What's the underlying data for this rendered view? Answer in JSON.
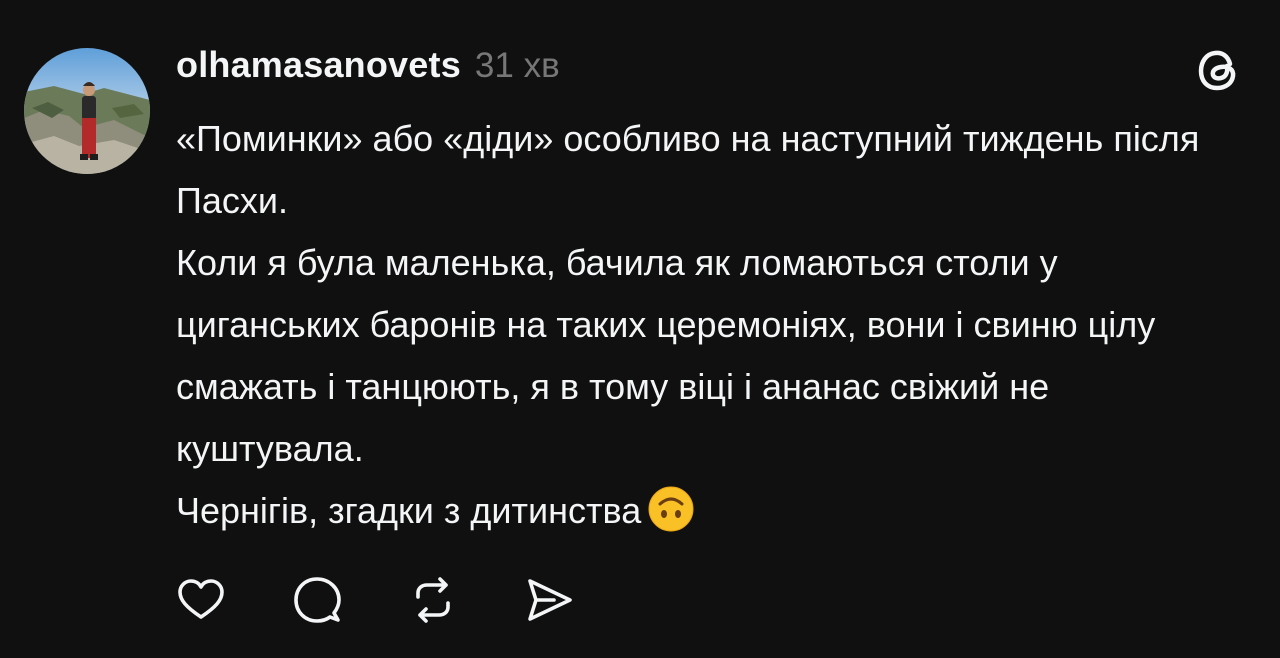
{
  "post": {
    "username": "olhamasanovets",
    "timestamp": "31 хв",
    "paragraphs": [
      "«Поминки» або «діди» особливо на наступний тиждень після Пасхи.",
      "Коли я була маленька, бачила як ломаються столи у циганських баронів на таких церемоніях, вони і свиню цілу смажать і танцюють, я в тому віці і ананас свіжий не куштувала.",
      "Чернігів, згадки з дитинства"
    ],
    "emoji": "upside-down-face-emoji"
  },
  "icons": {
    "logo": "threads-logo-icon",
    "like": "heart-icon",
    "reply": "comment-bubble-icon",
    "repost": "repost-icon",
    "share": "send-icon"
  },
  "colors": {
    "background": "#101010",
    "text": "#f3f5f7",
    "muted": "#777777"
  }
}
